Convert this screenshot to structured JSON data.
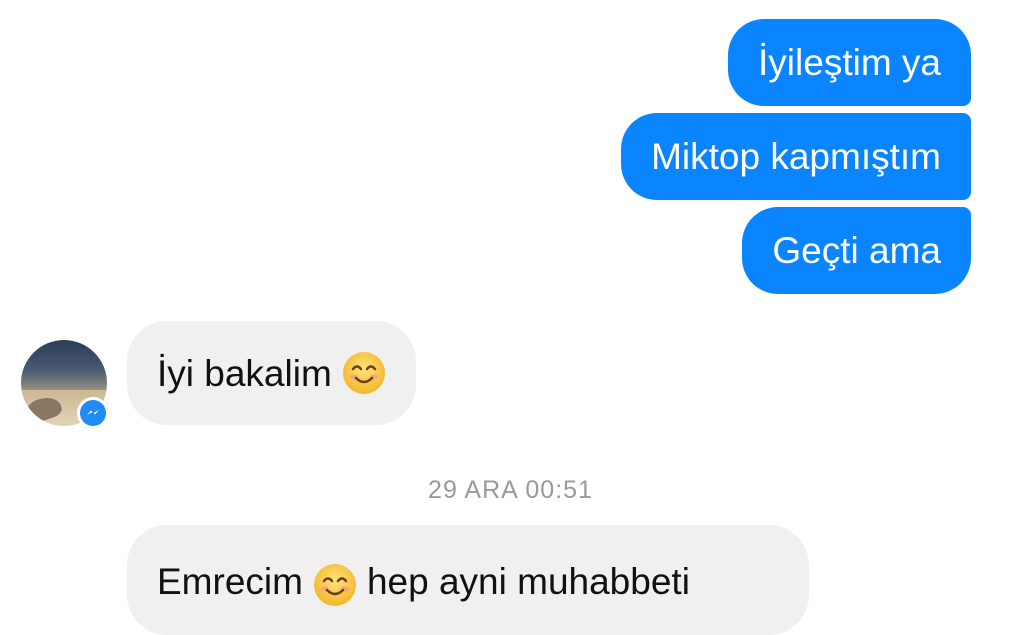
{
  "messages": {
    "out_1": "İyileştim ya",
    "out_2": "Miktop kapmıştım",
    "out_3": "Geçti ama",
    "in_1": "İyi bakalim",
    "in_2_before_emoji": "Emrecim",
    "in_2_after_emoji": "hep ayni muhabbeti"
  },
  "timestamp": "29 ARA 00:51",
  "icons": {
    "emoji_1": "smiling-face-emoji",
    "emoji_2": "smiling-face-emoji",
    "badge": "messenger-icon"
  },
  "colors": {
    "outgoing_bubble": "#0a84ff",
    "incoming_bubble": "#f1f0f0",
    "timestamp_text": "#9a9a9a",
    "messenger_badge": "#1f8bf6"
  }
}
